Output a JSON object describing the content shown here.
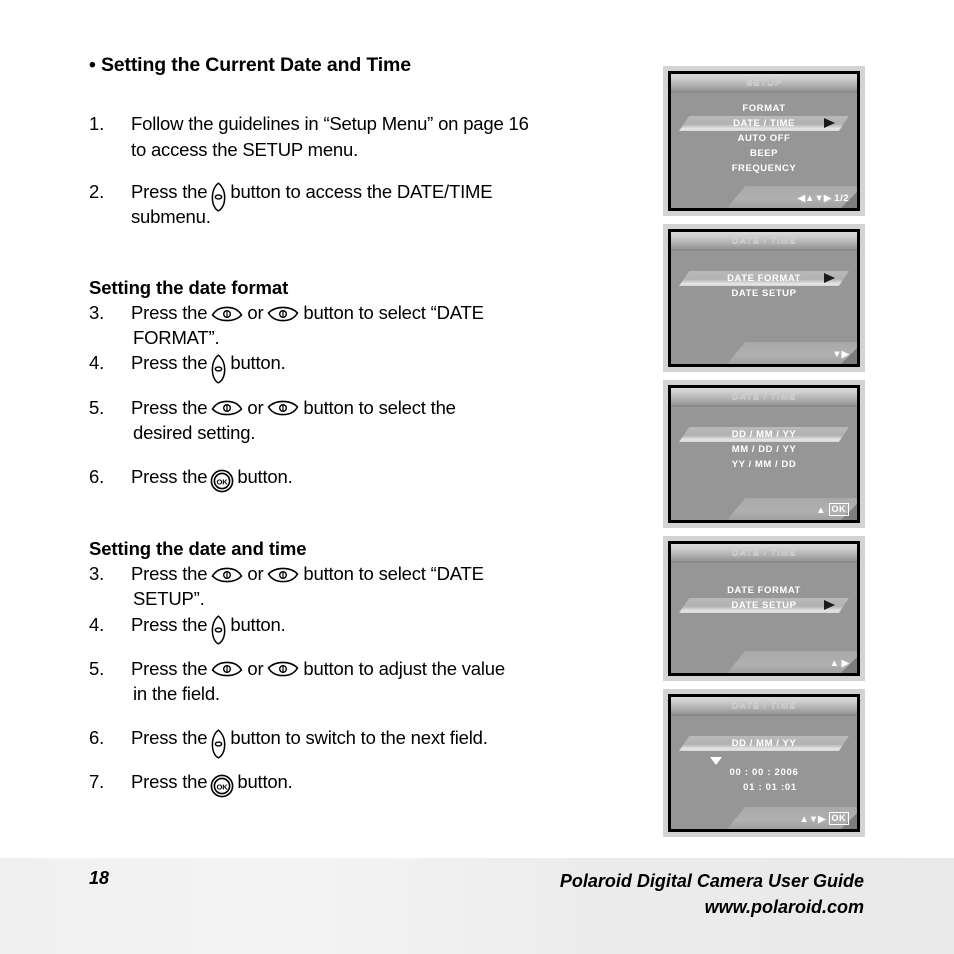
{
  "page": {
    "heading": "• Setting the Current Date and Time",
    "page_number": "18",
    "footer_title": "Polaroid Digital Camera User Guide",
    "footer_url": "www.polaroid.com"
  },
  "intro_steps": [
    {
      "num": "1.",
      "line1": "Follow the guidelines in “Setup Menu” on page 16",
      "line2": "to access the SETUP menu."
    },
    {
      "num": "2.",
      "pre": "Press the",
      "icon": "right-nav-button-icon",
      "post": "button to access the DATE/TIME",
      "line2": "submenu."
    }
  ],
  "section_format": {
    "heading": "Setting the date format",
    "steps": [
      {
        "num": "3.",
        "pre": "Press the",
        "icon_a": "up-nav-button-icon",
        "mid": "or",
        "icon_b": "down-nav-button-icon",
        "post": "button to select “DATE",
        "line2": "FORMAT”."
      },
      {
        "num": "4.",
        "pre": "Press the",
        "icon": "right-nav-button-icon",
        "post": "button."
      },
      {
        "num": "5.",
        "pre": "Press the",
        "icon_a": "up-nav-button-icon",
        "mid": "or",
        "icon_b": "down-nav-button-icon",
        "post": "button to select the",
        "line2": "desired setting."
      },
      {
        "num": "6.",
        "pre": "Press the",
        "icon": "ok-button-icon",
        "post": "button."
      }
    ]
  },
  "section_datetime": {
    "heading": "Setting the date and time",
    "steps": [
      {
        "num": "3.",
        "pre": "Press the",
        "icon_a": "up-nav-button-icon",
        "mid": "or",
        "icon_b": "down-nav-button-icon",
        "post": "button to select “DATE",
        "line2": "SETUP”."
      },
      {
        "num": "4.",
        "pre": "Press the",
        "icon": "right-nav-button-icon",
        "post": "button."
      },
      {
        "num": "5.",
        "pre": "Press the",
        "icon_a": "up-nav-button-icon",
        "mid": "or",
        "icon_b": "down-nav-button-icon",
        "post": "button to adjust the value",
        "line2": "in the field."
      },
      {
        "num": "6.",
        "pre": "Press the",
        "icon": "right-nav-button-icon",
        "post": "button to switch to the next field."
      },
      {
        "num": "7.",
        "pre": "Press the",
        "icon": "ok-button-icon",
        "post": "button."
      }
    ]
  },
  "screens": [
    {
      "title": "SETUP",
      "items": [
        "FORMAT",
        "DATE / TIME",
        "AUTO OFF",
        "BEEP",
        "FREQUENCY"
      ],
      "selected_index": 1,
      "arrow": "black",
      "footer_keys": "◀▲▼▶",
      "footer_extra": "1/2",
      "footer_ok": ""
    },
    {
      "title": "DATE / TIME",
      "items": [
        "DATE FORMAT",
        "DATE SETUP"
      ],
      "selected_index": 0,
      "arrow": "black",
      "footer_keys": "▼▶",
      "footer_extra": "",
      "footer_ok": ""
    },
    {
      "title": "DATE / TIME",
      "items": [
        "DD / MM / YY",
        "MM / DD / YY",
        "YY / MM / DD"
      ],
      "selected_index": 0,
      "arrow": "none",
      "footer_keys": "▲",
      "footer_extra": "",
      "footer_ok": "OK"
    },
    {
      "title": "DATE / TIME",
      "items": [
        "DATE FORMAT",
        "DATE SETUP"
      ],
      "selected_index": 1,
      "arrow": "black",
      "footer_keys": "▲  ▶",
      "footer_extra": "",
      "footer_ok": ""
    },
    {
      "title": "DATE / TIME",
      "items": [
        "DD / MM / YY"
      ],
      "selected_index": 0,
      "arrow": "none",
      "time_line1": "00 : 00 : 2006",
      "time_line2": "01 : 01 :01",
      "footer_keys": "▲▼▶",
      "footer_extra": "",
      "footer_ok": "OK"
    }
  ],
  "colors": {
    "lcd_body": "#969696",
    "bezel": "#d3d3d3",
    "highlight": "#c2c2c2",
    "text_white": "#ffffff"
  }
}
